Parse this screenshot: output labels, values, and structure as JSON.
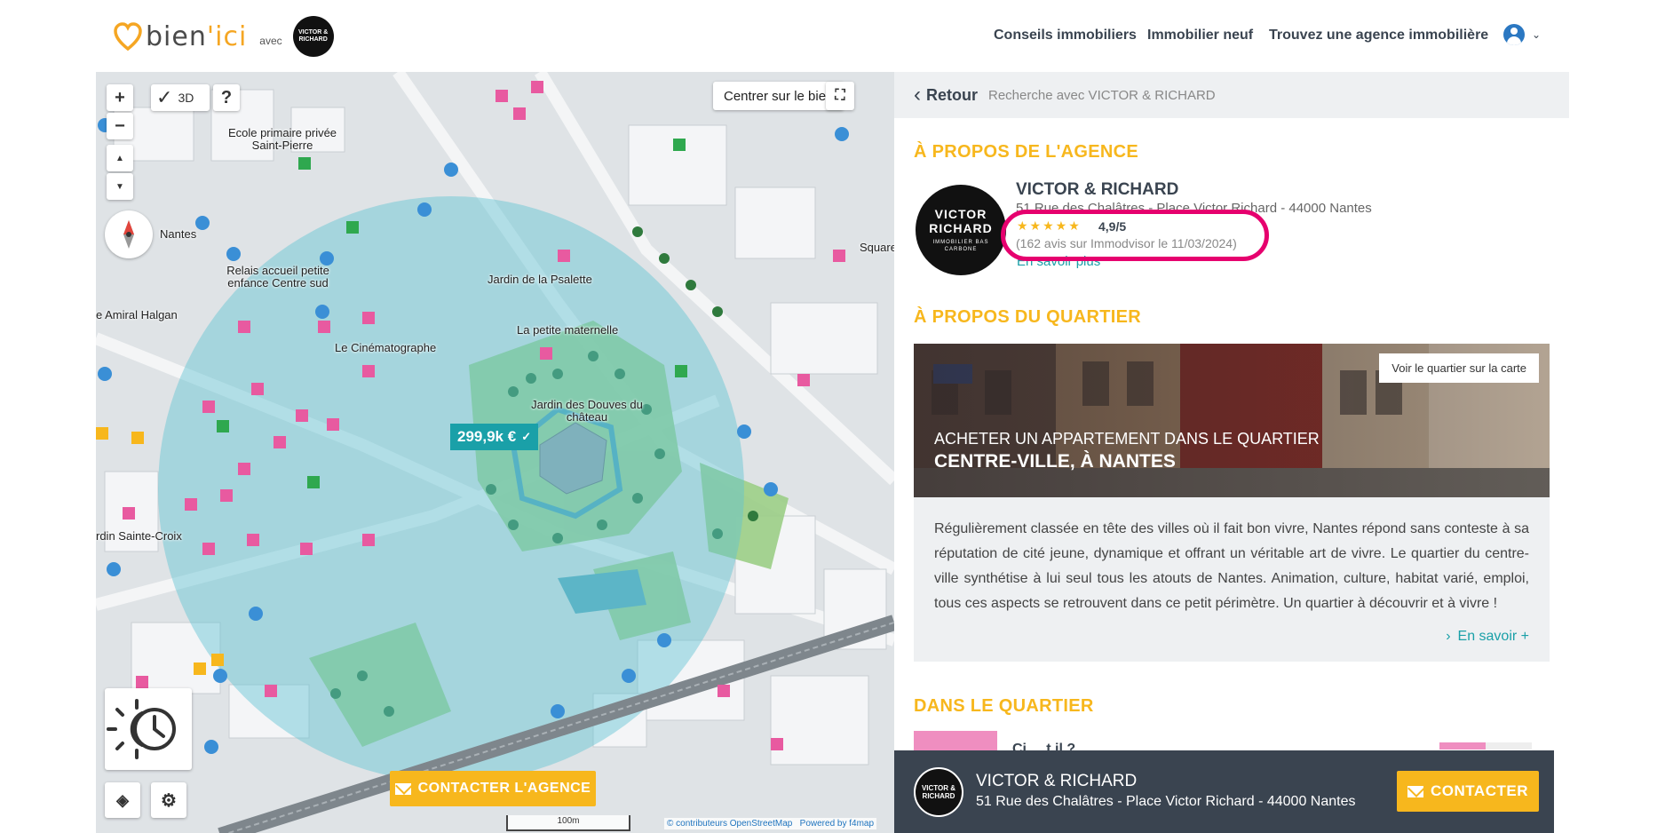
{
  "header": {
    "logo": {
      "part1": "bien",
      "apostrophe": "'",
      "part2": "ici",
      "avec": "avec",
      "partner_badge": "VICTOR & RICHARD"
    },
    "nav": [
      {
        "label": "Conseils immobiliers"
      },
      {
        "label": "Immobilier neuf"
      },
      {
        "label": "Trouvez une agence immobilière"
      }
    ],
    "user_icon": "user-circle-icon",
    "dropdown_icon": "chevron-down-icon"
  },
  "map": {
    "controls": {
      "zoom_in": "+",
      "zoom_out": "−",
      "mode_3d": "3D",
      "help": "?",
      "tilt_up": "▲",
      "tilt_down": "▼",
      "center_label": "Centrer sur le bien",
      "fullscreen_icon": "fullscreen-icon"
    },
    "labels": [
      "Ecole primaire privée Saint-Pierre",
      "Nantes",
      "Relais accueil petite enfance Centre sud",
      "e Amiral Halgan",
      "Jardin de la Psalette",
      "Le Cinématographe",
      "La petite maternelle",
      "Jardin des Douves du château",
      "rdin Sainte-Croix",
      "Square"
    ],
    "price_tag": "299,9k €",
    "price_check": "✓",
    "contact_agency": "CONTACTER L'AGENCE",
    "scale": "100m",
    "attribution": "© contributeurs OpenStreetMap",
    "powered": "Powered by f4map"
  },
  "panel": {
    "back": "Retour",
    "breadcrumb": "Recherche avec VICTOR & RICHARD",
    "about_agency_title": "À PROPOS DE L'AGENCE",
    "agency": {
      "logo_line1": "VICTOR",
      "logo_line2": "RICHARD",
      "logo_line3": "IMMOBILIER BAS CARBONE",
      "name": "VICTOR & RICHARD",
      "address": "51 Rue des Chalâtres - Place Victor Richard - 44000 Nantes",
      "stars": "★★★★★",
      "rating": "4,9/5",
      "reviews": "(162 avis sur Immodvisor le 11/03/2024)",
      "more": "En savoir plus"
    },
    "about_quartier_title": "À PROPOS DU QUARTIER",
    "hero": {
      "see_on_map": "Voir le quartier sur la carte",
      "subtitle": "ACHETER UN APPARTEMENT DANS LE QUARTIER",
      "title": "CENTRE-VILLE, À NANTES"
    },
    "description": "Régulièrement classée en tête des villes où il fait bon vivre, Nantes répond sans conteste à sa réputation de cité jeune, dynamique et offrant un véritable art de vivre. Le quartier du centre-ville synthétise à lui seul tous les atouts de Nantes. Animation, culture, habitat varié, emploi, tous ces aspects se retrouvent dans ce petit périmètre. Un quartier à découvrir et à vivre !",
    "description_more": "En savoir +",
    "in_quartier_title": "DANS LE QUARTIER",
    "in_quartier_item": "Ci ... t il ?",
    "in_quartier_progress": 0.5
  },
  "bottom_bar": {
    "logo": "VICTOR & RICHARD",
    "name": "VICTOR & RICHARD",
    "address": "51 Rue des Chalâtres - Place Victor Richard - 44000 Nantes",
    "cta": "CONTACTER"
  },
  "colors": {
    "accent": "#f7b71d",
    "teal": "#1aa0a8",
    "dark": "#3a4450",
    "highlight": "#e6006e"
  }
}
